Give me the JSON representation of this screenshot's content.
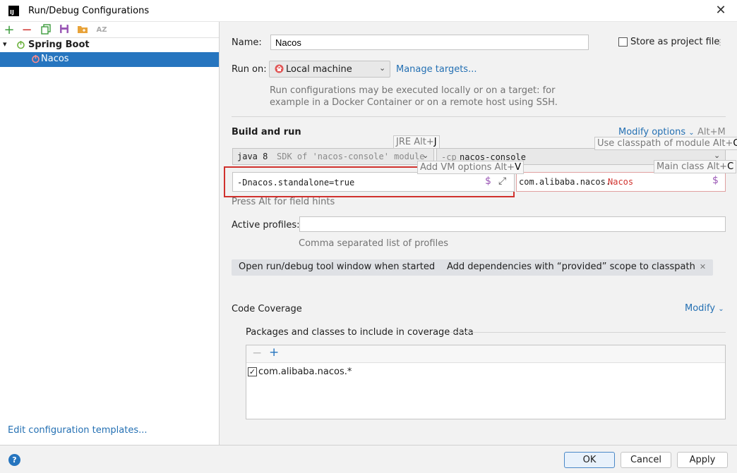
{
  "window": {
    "title": "Run/Debug Configurations",
    "app_icon_text": "IJ"
  },
  "sidebar": {
    "toolbar_icons": [
      "add-icon",
      "remove-icon",
      "copy-icon",
      "save-icon",
      "folder-icon",
      "sort-icon"
    ],
    "group": {
      "label": "Spring Boot"
    },
    "selected_item": {
      "label": "Nacos"
    },
    "edit_templates_link": "Edit configuration templates..."
  },
  "form": {
    "name_label": "Name:",
    "name_value": "Nacos",
    "store_label": "Store as project file",
    "store_checked": false,
    "run_on_label": "Run on:",
    "run_on_value": "Local machine",
    "manage_targets": "Manage targets...",
    "run_on_help_line1": "Run configurations may be executed locally or on a target: for",
    "run_on_help_line2": "example in a Docker Container or on a remote host using SSH.",
    "build_run_heading": "Build and run",
    "modify_options": "Modify options",
    "modify_options_shortcut": "Alt+M",
    "jre_value_bold": "java 8",
    "jre_value_hint": "SDK of 'nacos-console' module",
    "classpath_prefix": "-cp",
    "classpath_value": "nacos-console",
    "vm_options_value": "-Dnacos.standalone=true",
    "main_class_prefix": "com.alibaba.nacos.",
    "main_class_suffix": "Nacos",
    "field_hints_text": "Press Alt for field hints",
    "active_profiles_label": "Active profiles:",
    "active_profiles_value": "",
    "active_profiles_hint": "Comma separated list of profiles",
    "tags": [
      "Open run/debug tool window when started",
      "Add dependencies with “provided” scope to classpath"
    ],
    "tooltips": {
      "jre": "JRE Alt+",
      "jre_key": "J",
      "vm": "Add VM options Alt+",
      "vm_key": "V",
      "classpath": "Use classpath of module Alt+",
      "classpath_key": "O",
      "main_class": "Main class Alt+",
      "main_class_key": "C"
    },
    "code_coverage_heading": "Code Coverage",
    "modify_link": "Modify",
    "packages_label": "Packages and classes to include in coverage data",
    "coverage_items": [
      {
        "label": "com.alibaba.nacos.*",
        "checked": true
      }
    ]
  },
  "buttons": {
    "ok": "OK",
    "cancel": "Cancel",
    "apply": "Apply"
  },
  "colors": {
    "accent": "#2675bf",
    "link": "#2470b3",
    "highlight_border": "#d0312d",
    "error_text": "#d0312d"
  }
}
